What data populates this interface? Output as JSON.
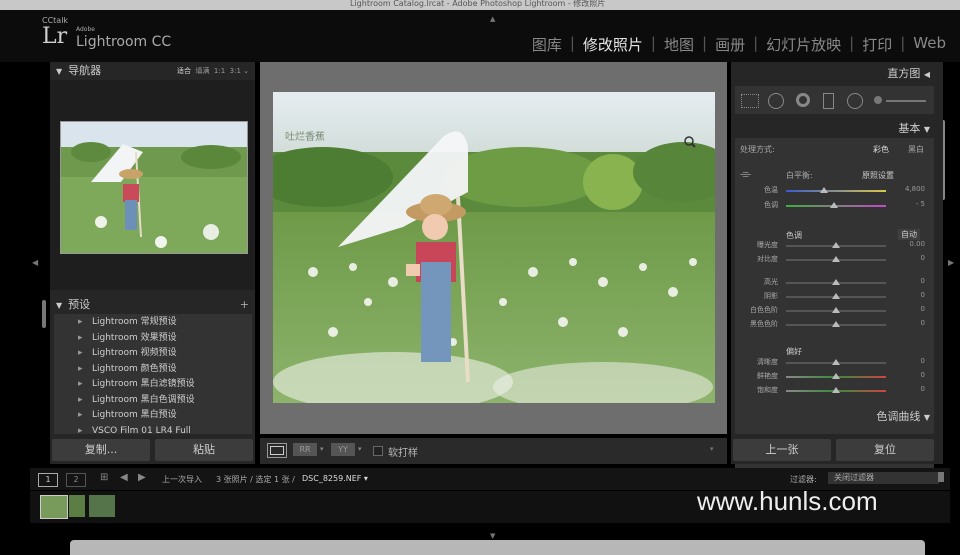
{
  "window_title": "Lightroom Catalog.lrcat - Adobe Photoshop Lightroom - 修改照片",
  "logo": {
    "cc": "CC",
    "talk": "talk",
    "lr": "Lr",
    "adobe": "Adobe",
    "product": "Lightroom CC"
  },
  "modules": [
    {
      "label": "图库",
      "active": false
    },
    {
      "label": "修改照片",
      "active": true
    },
    {
      "label": "地图",
      "active": false
    },
    {
      "label": "画册",
      "active": false
    },
    {
      "label": "幻灯片放映",
      "active": false
    },
    {
      "label": "打印",
      "active": false
    },
    {
      "label": "Web",
      "active": false
    }
  ],
  "navigator": {
    "title": "导航器",
    "opts": [
      "适合",
      "填满",
      "1:1",
      "3:1"
    ]
  },
  "presets": {
    "title": "预设",
    "items": [
      "Lightroom 常规预设",
      "Lightroom 效果预设",
      "Lightroom 视频预设",
      "Lightroom 颜色预设",
      "Lightroom 黑白滤镜预设",
      "Lightroom 黑白色调预设",
      "Lightroom 黑白预设",
      "VSCO Film 01 LR4 Full"
    ]
  },
  "left_buttons": {
    "copy": "复制...",
    "paste": "粘贴"
  },
  "photo_watermark": "吐烂香蕉",
  "toolbar": {
    "softproof": "软打样"
  },
  "right": {
    "histogram": "直方图",
    "basic": "基本",
    "treatment_label": "处理方式:",
    "color": "彩色",
    "bw": "黑白",
    "wb_label": "白平衡:",
    "wb_value": "原照设置",
    "temp_label": "色温",
    "temp_value": "4,800",
    "tint_label": "色调",
    "tint_value": "- 5",
    "tone_title": "色调",
    "auto": "自动",
    "exposure_label": "曝光度",
    "exposure_value": "0.00",
    "contrast_label": "对比度",
    "contrast_value": "0",
    "highlights_label": "高光",
    "highlights_value": "0",
    "shadows_label": "阴影",
    "shadows_value": "0",
    "whites_label": "白色色阶",
    "whites_value": "0",
    "blacks_label": "黑色色阶",
    "blacks_value": "0",
    "presence_title": "偏好",
    "clarity_label": "清晰度",
    "clarity_value": "0",
    "vibrance_label": "鲜艳度",
    "vibrance_value": "0",
    "saturation_label": "饱和度",
    "saturation_value": "0",
    "tone_curve": "色调曲线",
    "prev": "上一张",
    "reset": "复位"
  },
  "filmbar": {
    "page1": "1",
    "page2": "2",
    "source": "上一次导入",
    "count": "3 张照片 / 选定 1 张 /",
    "filename": "DSC_8259.NEF",
    "filter_label": "过滤器:",
    "filter_value": "关闭过滤器"
  },
  "watermark_site": "www.hunls.com"
}
